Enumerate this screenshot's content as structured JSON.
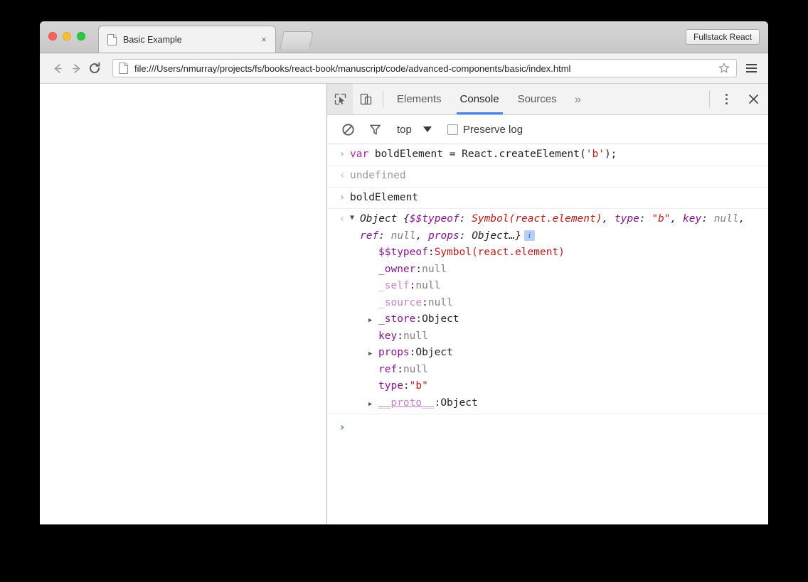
{
  "browser": {
    "tab": {
      "title": "Basic Example",
      "close_label": "×"
    },
    "new_tab_label": "",
    "omnibox": {
      "url": "file:///Users/nmurray/projects/fs/books/react-book/manuscript/code/advanced-components/basic/index.html"
    },
    "extension_button_label": "Fullstack React",
    "nav": {
      "back_icon": "arrow-left-icon",
      "forward_icon": "arrow-right-icon",
      "reload_icon": "reload-icon",
      "bookmark_icon": "star-icon",
      "menu_icon": "hamburger-menu-icon"
    },
    "traffic_lights": {
      "close_color": "#ff5f57",
      "minimize_color": "#febc2e",
      "zoom_color": "#28c840"
    }
  },
  "devtools": {
    "inspect_button": "inspect-element-icon",
    "device_toolbar_button": "device-toggle-icon",
    "tabs": [
      {
        "label": "Elements",
        "active": false
      },
      {
        "label": "Console",
        "active": true
      },
      {
        "label": "Sources",
        "active": false
      }
    ],
    "more_tabs_label": "»",
    "kebab_label": "more-options",
    "close_label": "✕",
    "accent_color": "#4285f4",
    "filterbar": {
      "clear_icon": "clear-console-icon",
      "filter_icon": "filter-funnel-icon",
      "context_label": "top",
      "preserve_log_label": "Preserve log",
      "preserve_log_checked": false
    },
    "console": {
      "entries": [
        {
          "kind": "input",
          "gutter": "›",
          "tokens": [
            {
              "text": "var",
              "style": "kw"
            },
            {
              "text": " boldElement = React.createElement(",
              "style": "plain"
            },
            {
              "text": "'b'",
              "style": "str"
            },
            {
              "text": ");",
              "style": "plain"
            }
          ]
        },
        {
          "kind": "output",
          "gutter": "‹",
          "tokens": [
            {
              "text": "undefined",
              "style": "dim"
            }
          ]
        },
        {
          "kind": "input",
          "gutter": "›",
          "tokens": [
            {
              "text": "boldElement",
              "style": "plain"
            }
          ]
        }
      ],
      "object_result": {
        "gutter": "‹",
        "triangle": "▼",
        "summary": [
          {
            "text": "Object ",
            "style": "obj"
          },
          {
            "text": "{",
            "style": "obj"
          },
          {
            "text": "$$typeof",
            "style": "prop"
          },
          {
            "text": ": ",
            "style": "obj"
          },
          {
            "text": "Symbol(react.element)",
            "style": "red"
          },
          {
            "text": ", ",
            "style": "obj"
          },
          {
            "text": "type",
            "style": "prop"
          },
          {
            "text": ": ",
            "style": "obj"
          },
          {
            "text": "\"b\"",
            "style": "red"
          },
          {
            "text": ", ",
            "style": "obj"
          },
          {
            "text": "key",
            "style": "prop"
          },
          {
            "text": ": ",
            "style": "obj"
          },
          {
            "text": "null",
            "style": "null"
          },
          {
            "text": ", ",
            "style": "obj"
          },
          {
            "text": "ref",
            "style": "prop"
          },
          {
            "text": ": ",
            "style": "obj"
          },
          {
            "text": "null",
            "style": "null"
          },
          {
            "text": ", ",
            "style": "obj"
          },
          {
            "text": "props",
            "style": "prop"
          },
          {
            "text": ": ",
            "style": "obj"
          },
          {
            "text": "Object…",
            "style": "obj"
          },
          {
            "text": "}",
            "style": "obj"
          }
        ],
        "info_badge": "i",
        "properties": [
          {
            "expandable": false,
            "name": "$$typeof",
            "name_style": "prop",
            "value": "Symbol(react.element)",
            "value_style": "red"
          },
          {
            "expandable": false,
            "name": "_owner",
            "name_style": "prop",
            "value": "null",
            "value_style": "null"
          },
          {
            "expandable": false,
            "name": "_self",
            "name_style": "prop-light",
            "value": "null",
            "value_style": "null"
          },
          {
            "expandable": false,
            "name": "_source",
            "name_style": "prop-light",
            "value": "null",
            "value_style": "null"
          },
          {
            "expandable": true,
            "name": "_store",
            "name_style": "prop",
            "value": "Object",
            "value_style": "obj"
          },
          {
            "expandable": false,
            "name": "key",
            "name_style": "prop",
            "value": "null",
            "value_style": "null"
          },
          {
            "expandable": true,
            "name": "props",
            "name_style": "prop",
            "value": "Object",
            "value_style": "obj"
          },
          {
            "expandable": false,
            "name": "ref",
            "name_style": "prop",
            "value": "null",
            "value_style": "null"
          },
          {
            "expandable": false,
            "name": "type",
            "name_style": "prop",
            "value": "\"b\"",
            "value_style": "red"
          },
          {
            "expandable": true,
            "name": "__proto__",
            "name_style": "proto",
            "value": "Object",
            "value_style": "obj"
          }
        ],
        "expand_triangle": "▶"
      },
      "prompt": {
        "caret": "›",
        "value": ""
      }
    }
  }
}
